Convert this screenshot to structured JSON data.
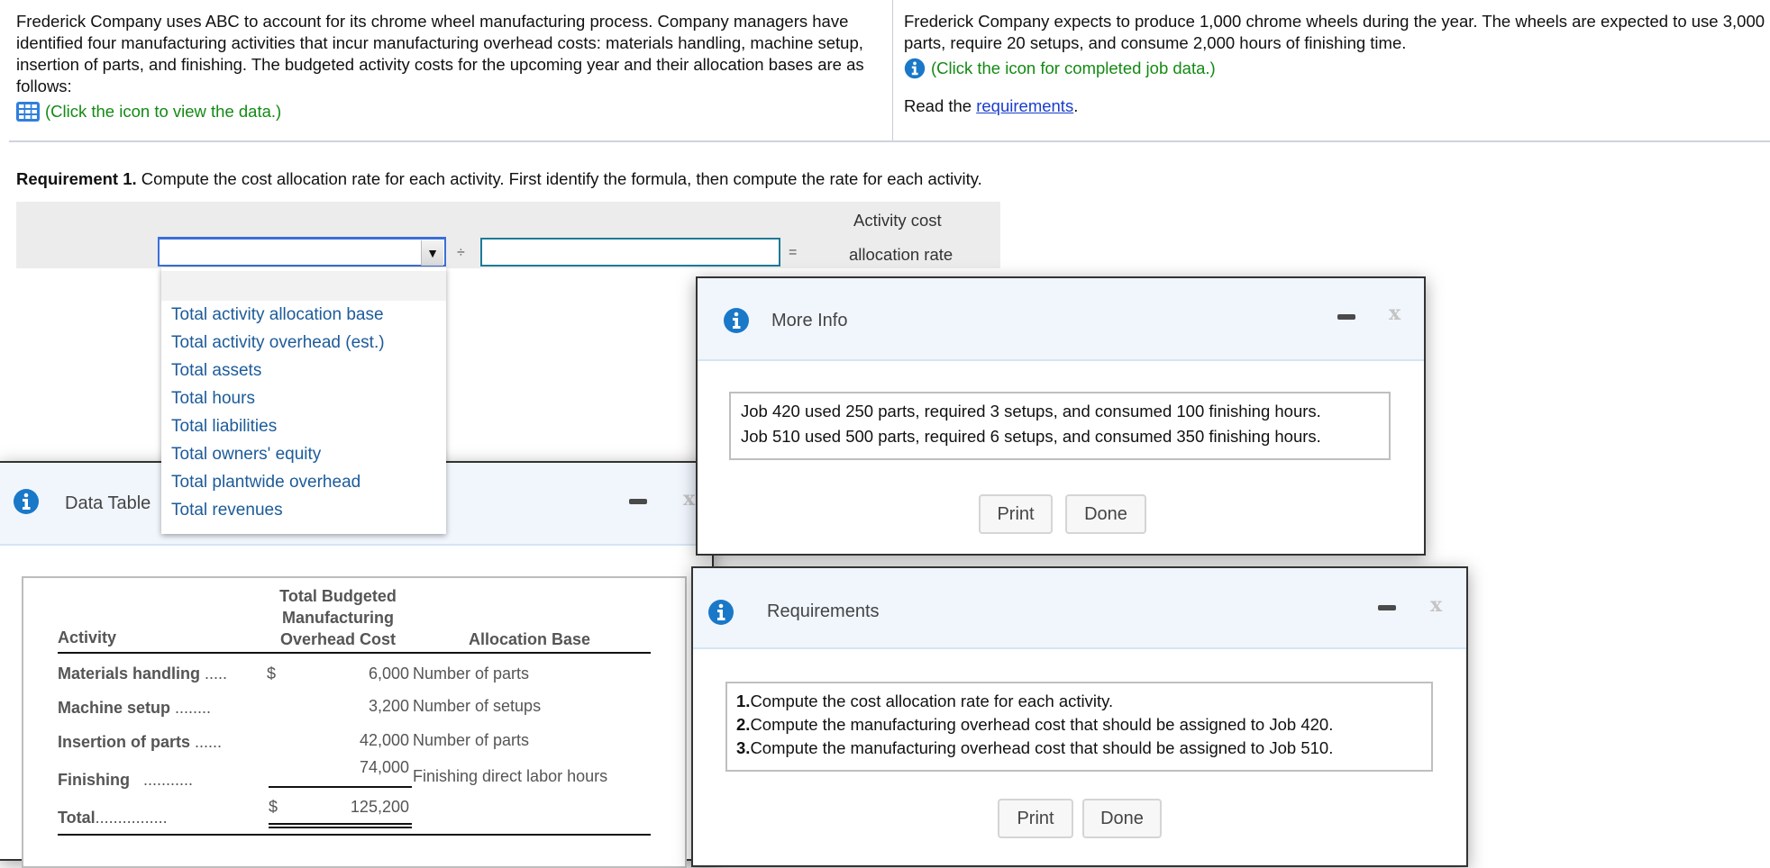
{
  "problem": {
    "left_text": "Frederick Company uses ABC to account for its chrome wheel manufacturing process. Company managers have identified four manufacturing activities that incur manufacturing overhead costs: materials handling, machine setup, insertion of parts, and finishing. The budgeted activity costs for the upcoming year and their allocation bases are as follows:",
    "data_link": "(Click the icon to view the data.)",
    "right_text": "Frederick Company expects to produce 1,000 chrome wheels during the year. The wheels are expected to use 3,000 parts, require 20 setups, and consume 2,000 hours of finishing time.",
    "job_link": "(Click the icon for completed job data.)",
    "read_prefix": "Read the ",
    "read_link": "requirements",
    "read_suffix": "."
  },
  "requirement1": {
    "label": "Requirement 1.",
    "text": " Compute the cost allocation rate for each activity. First identify the formula, then compute the rate for each activity."
  },
  "formula": {
    "select_value": "",
    "divide_sign": "÷",
    "input_value": "",
    "equals_sign": "=",
    "result_label_1": "Activity cost",
    "result_label_2": "allocation rate",
    "options": [
      "Total activity allocation base",
      "Total activity overhead (est.)",
      "Total assets",
      "Total hours",
      "Total liabilities",
      "Total owners' equity",
      "Total plantwide overhead",
      "Total revenues"
    ]
  },
  "data_table": {
    "title": "Data Table",
    "headers": {
      "activity": "Activity",
      "cost_1": "Total Budgeted",
      "cost_2": "Manufacturing",
      "cost_3": "Overhead Cost",
      "base": "Allocation Base"
    },
    "rows": [
      {
        "activity": "Materials handling",
        "dots": ".....",
        "currency": "$",
        "cost": "6,000",
        "base": "Number of parts"
      },
      {
        "activity": "Machine setup",
        "dots": "........",
        "currency": "",
        "cost": "3,200",
        "base": "Number of setups"
      },
      {
        "activity": "Insertion of parts",
        "dots": "......",
        "currency": "",
        "cost": "42,000",
        "base": "Number of parts"
      },
      {
        "activity": "Finishing",
        "dots": "...........",
        "currency": "",
        "cost": "74,000",
        "base": "Finishing direct labor hours"
      }
    ],
    "total": {
      "activity": "Total",
      "dots": "................",
      "currency": "$",
      "cost": "125,200"
    }
  },
  "more_info": {
    "title": "More Info",
    "lines": [
      "Job 420 used 250 parts, required 3 setups, and consumed 100 finishing hours.",
      "Job 510 used 500 parts, required 6 setups, and consumed 350 finishing hours."
    ],
    "print": "Print",
    "done": "Done"
  },
  "requirements": {
    "title": "Requirements",
    "items": [
      {
        "num": "1.",
        "text": "Compute the cost allocation rate for each activity."
      },
      {
        "num": "2.",
        "text": "Compute the manufacturing overhead cost that should be assigned to Job 420."
      },
      {
        "num": "3.",
        "text": "Compute the manufacturing overhead cost that should be assigned to Job 510."
      }
    ],
    "print": "Print",
    "done": "Done"
  },
  "colors": {
    "link_green": "#138a13",
    "link_blue": "#1a3ccc",
    "dropdown_text": "#1c5b9a",
    "info_blue": "#1a78c8",
    "dialog_header": "#f1f6fd"
  }
}
